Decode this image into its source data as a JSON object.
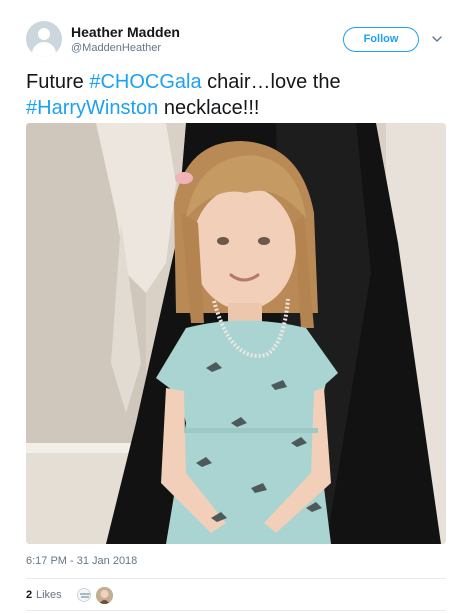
{
  "user": {
    "display_name": "Heather Madden",
    "handle": "@MaddenHeather",
    "avatar_icon": "default-profile-icon"
  },
  "header": {
    "follow_label": "Follow",
    "menu_icon": "chevron-down-icon"
  },
  "tweet": {
    "text_1": "Future ",
    "hashtag_1": "#CHOCGala",
    "text_2": " chair…love the",
    "hashtag_2": "#HarryWinston",
    "text_3": " necklace!!!"
  },
  "timestamp": "6:17 PM - 31 Jan 2018",
  "likes": {
    "count": "2",
    "label": "Likes"
  },
  "colors": {
    "accent": "#1da1f2",
    "text": "#14171a",
    "muted": "#657786",
    "divider": "#e6ecf0"
  }
}
